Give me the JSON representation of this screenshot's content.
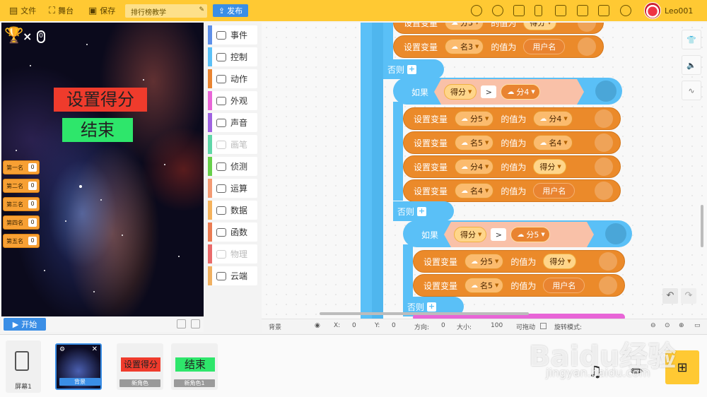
{
  "topbar": {
    "file": "文件",
    "stage": "舞台",
    "save": "保存",
    "project_name": "排行榜教学",
    "publish": "发布",
    "username": "Leo001"
  },
  "stage": {
    "score_label": "设置得分",
    "end_label": "结束",
    "counter": "0",
    "ranks": [
      {
        "label": "第一名",
        "value": "0"
      },
      {
        "label": "第二名",
        "value": "0"
      },
      {
        "label": "第三名",
        "value": "0"
      },
      {
        "label": "第四名",
        "value": "0"
      },
      {
        "label": "第五名",
        "value": "0"
      }
    ],
    "start": "开始"
  },
  "categories": [
    {
      "label": "事件",
      "color": "#5d8fe8"
    },
    {
      "label": "控制",
      "color": "#5ac0f7"
    },
    {
      "label": "动作",
      "color": "#e98431"
    },
    {
      "label": "外观",
      "color": "#e865d7"
    },
    {
      "label": "声音",
      "color": "#9f62e0"
    },
    {
      "label": "画笔",
      "color": "#5fd6a8"
    },
    {
      "label": "侦测",
      "color": "#67d04a"
    },
    {
      "label": "运算",
      "color": "#f39a73"
    },
    {
      "label": "数据",
      "color": "#f5b25c"
    },
    {
      "label": "函数",
      "color": "#ea7b52"
    },
    {
      "label": "物理",
      "color": "#e96a6a"
    },
    {
      "label": "云端",
      "color": "#f0b060"
    }
  ],
  "blocks": {
    "set_var": "设置变量",
    "value_of": "的值为",
    "else": "否则",
    "if": "如果",
    "top_partial": {
      "var": "分3",
      "val": "得分"
    },
    "row1": {
      "var": "名3",
      "val": "用户名"
    },
    "if1": {
      "left": "得分",
      "op": ">",
      "right": "分4"
    },
    "rows_a": [
      {
        "var": "分5",
        "val": "分4",
        "val_type": "var"
      },
      {
        "var": "名5",
        "val": "名4",
        "val_type": "var"
      },
      {
        "var": "分4",
        "val": "得分",
        "val_type": "sensor"
      },
      {
        "var": "名4",
        "val": "用户名",
        "val_type": "plain"
      }
    ],
    "if2": {
      "left": "得分",
      "op": ">",
      "right": "分5"
    },
    "rows_b": [
      {
        "var": "分5",
        "val": "得分",
        "val_type": "sensor"
      },
      {
        "var": "名5",
        "val": "用户名",
        "val_type": "plain"
      }
    ]
  },
  "props": {
    "name": "背景",
    "x_label": "X:",
    "x": "0",
    "y_label": "Y:",
    "y": "0",
    "dir_label": "方向:",
    "dir": "0",
    "size_label": "大小:",
    "size": "100",
    "drag_label": "可拖动",
    "rotate_label": "旋转模式:"
  },
  "bottom": {
    "screen": "屏幕1",
    "sprites": [
      {
        "tag": "",
        "label": "背景"
      },
      {
        "tag": "设置得分",
        "label": "新角色"
      },
      {
        "tag": "结束",
        "label": "新角色1"
      }
    ]
  },
  "watermark": {
    "main": "Baidu经验",
    "sub": "jingyan.baidu.com"
  }
}
